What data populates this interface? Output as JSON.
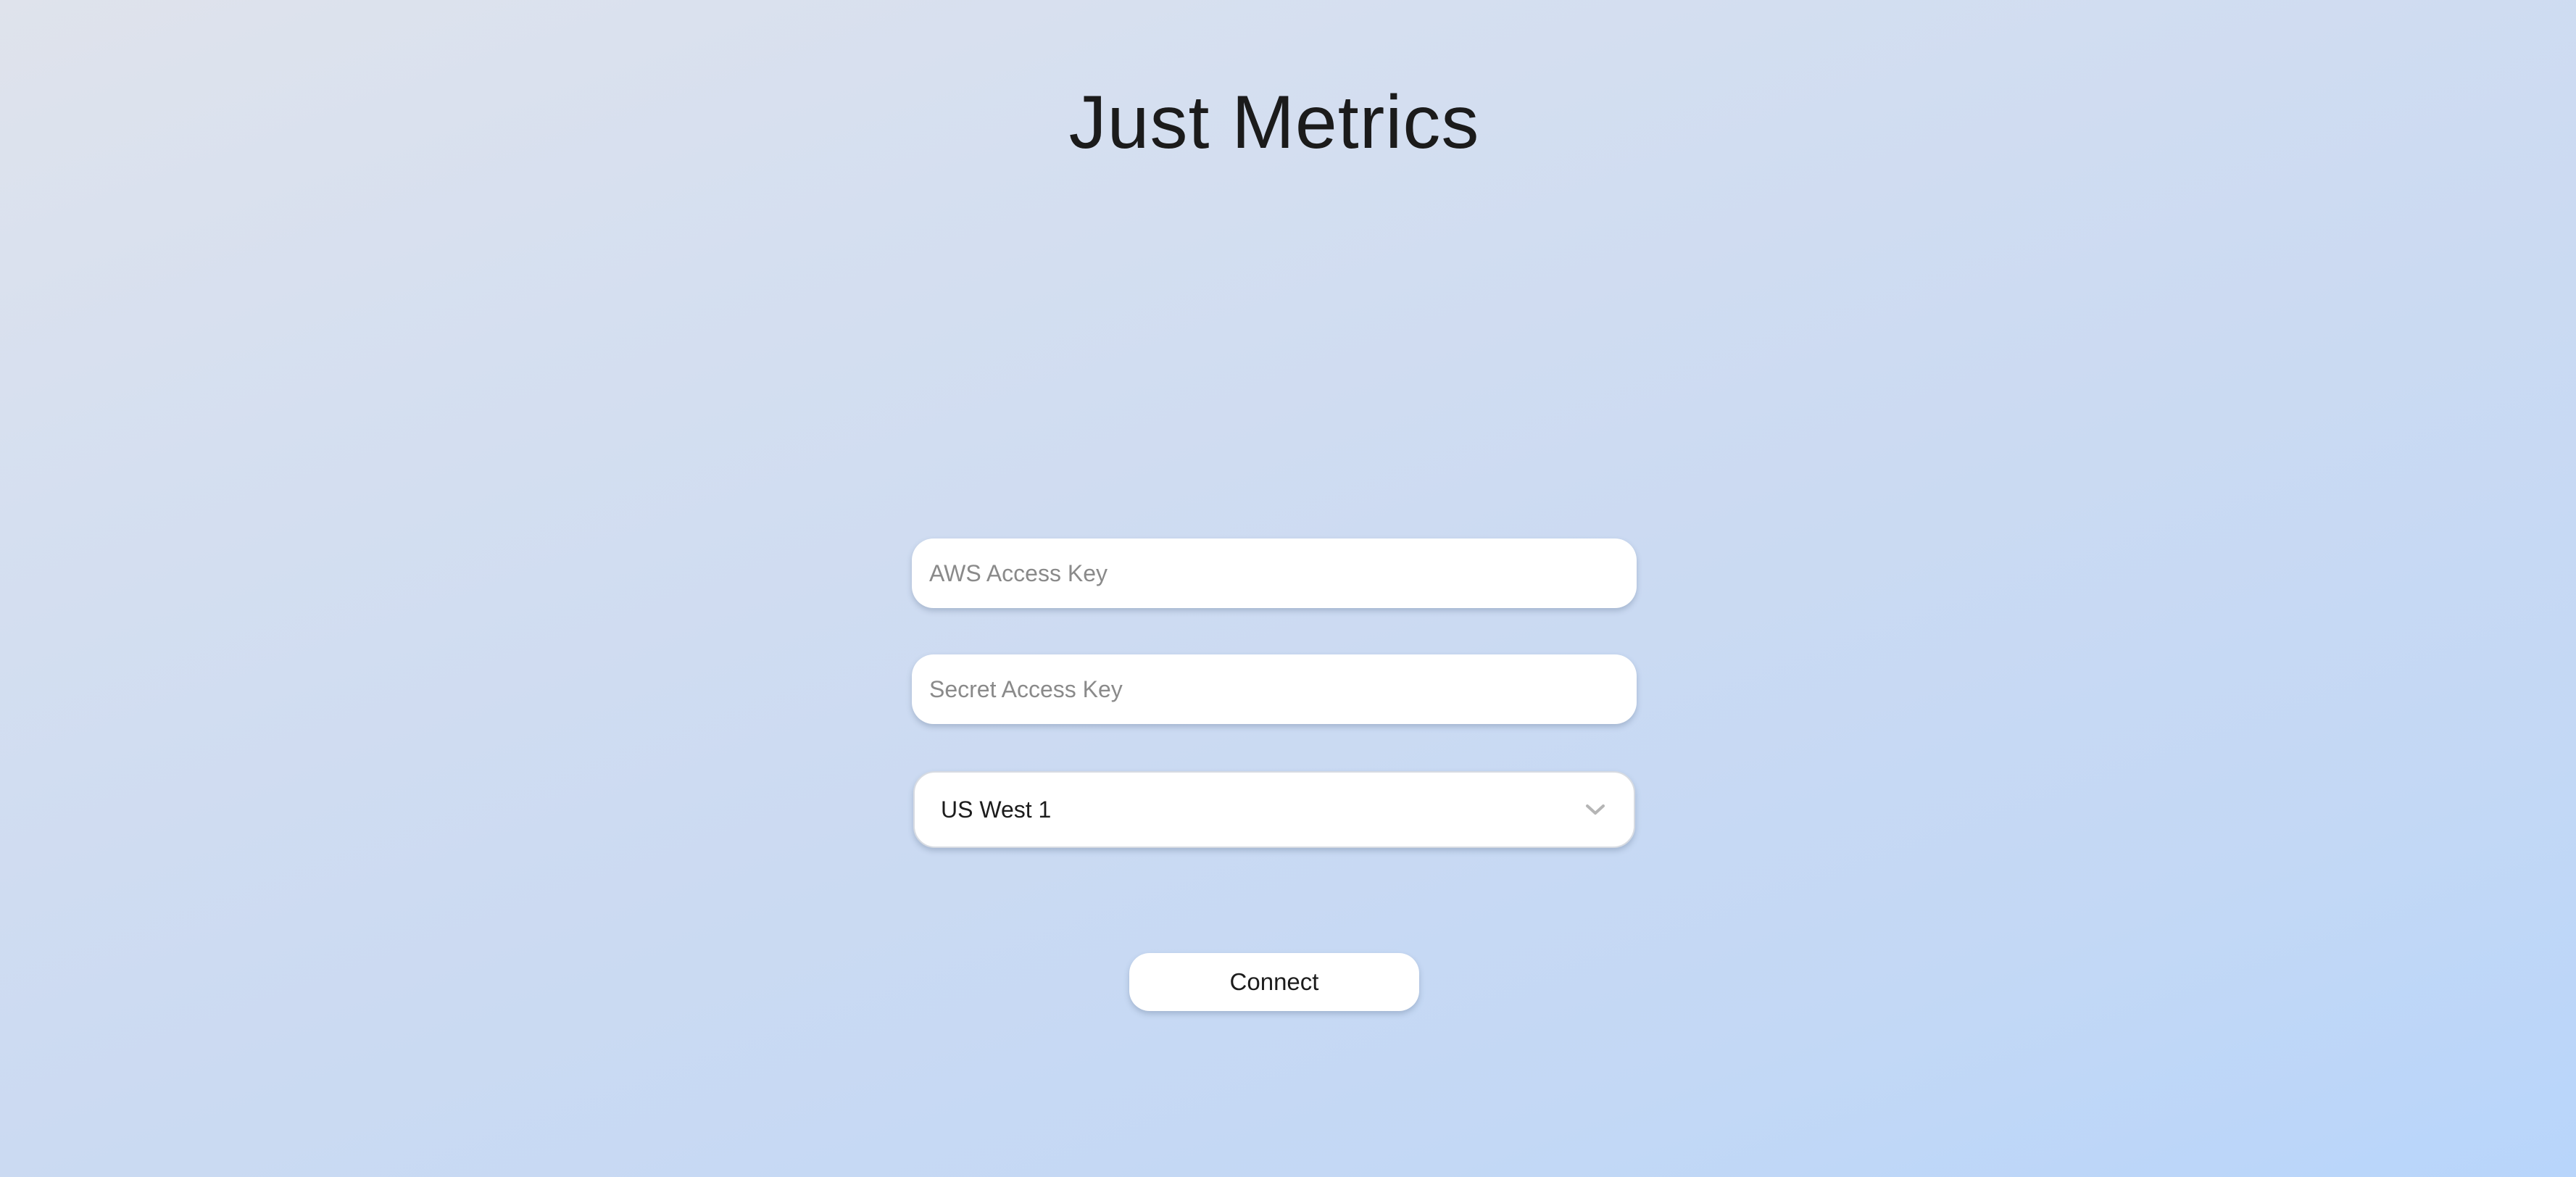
{
  "app": {
    "title": "Just Metrics"
  },
  "form": {
    "access_key": {
      "placeholder": "AWS Access Key",
      "value": ""
    },
    "secret_key": {
      "placeholder": "Secret Access Key",
      "value": ""
    },
    "region": {
      "selected": "US West 1",
      "icon": "chevron-down-icon"
    },
    "connect_label": "Connect"
  },
  "colors": {
    "background_start": "#dfe3ec",
    "background_end": "#b8d5fb",
    "field_background": "#ffffff",
    "text": "#1b1b1b",
    "placeholder": "#8a8a8a",
    "chevron": "#b5b5b5"
  }
}
